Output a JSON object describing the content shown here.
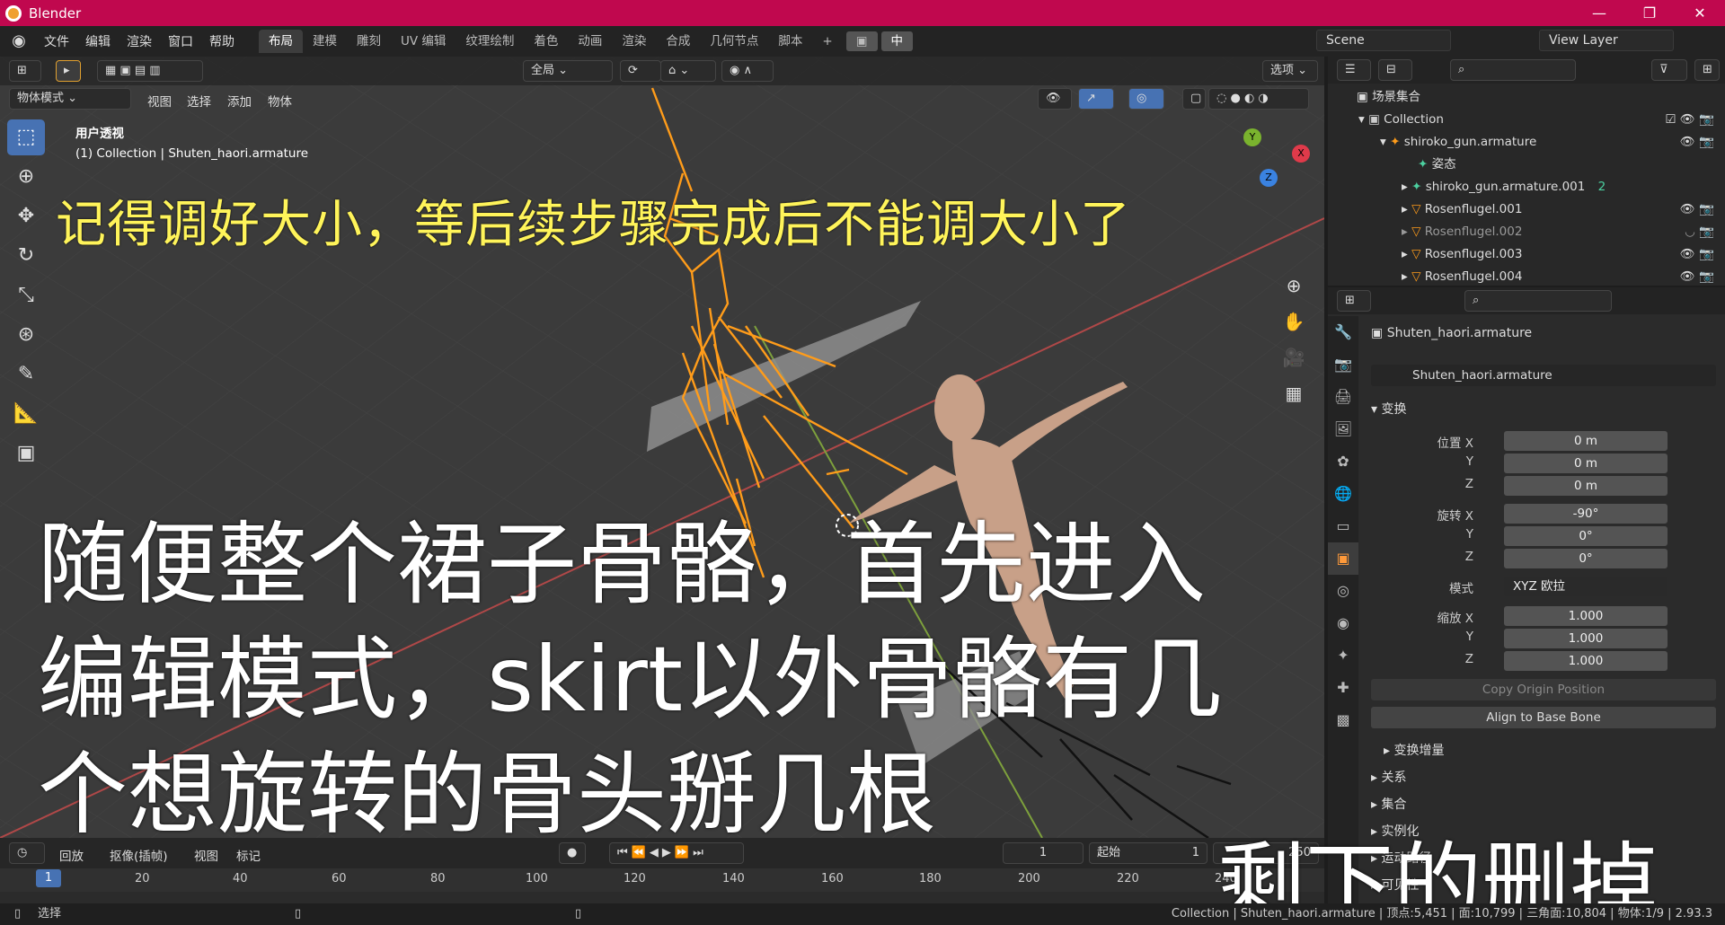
{
  "window": {
    "title": "Blender",
    "min": "—",
    "restore": "❐",
    "close": "✕"
  },
  "menubar": {
    "items": [
      "文件",
      "编辑",
      "渲染",
      "窗口",
      "帮助"
    ],
    "tabs": [
      "布局",
      "建模",
      "雕刻",
      "UV 编辑",
      "纹理绘制",
      "着色",
      "动画",
      "渲染",
      "合成",
      "几何节点",
      "脚本"
    ],
    "add_tab": "+",
    "lang_toggle": "中",
    "scene": "Scene",
    "view_layer": "View Layer"
  },
  "viewport": {
    "mode": "物体模式",
    "menus": [
      "视图",
      "选择",
      "添加",
      "物体"
    ],
    "orientation": "全局",
    "options": "选项",
    "view_name": "用户透视",
    "collection_info": "(1) Collection | Shuten_haori.armature",
    "gizmo": {
      "x": "X",
      "y": "Y",
      "z": "Z"
    }
  },
  "captions": {
    "top": "记得调好大小，等后续步骤完成后不能调大小了",
    "main_line1": "随便整个裙子骨骼，首先进入",
    "main_line2": "编辑模式，skirt以外骨骼有几",
    "main_line3": "个想旋转的骨头掰几根",
    "bottom": "剩下的删掉"
  },
  "timeline": {
    "playback": "回放",
    "keying": "抠像(插帧)",
    "view": "视图",
    "marker": "标记",
    "current_frame": "1",
    "start_label": "起始",
    "start_value": "1",
    "end_value": "250",
    "ruler": [
      "1",
      "20",
      "40",
      "60",
      "80",
      "100",
      "120",
      "140",
      "160",
      "180",
      "200",
      "220",
      "240"
    ]
  },
  "status": {
    "left": "选择",
    "right": "Collection | Shuten_haori.armature | 顶点:5,451 | 面:10,799 | 三角面:10,804 | 物体:1/9 | 2.93.3"
  },
  "outliner": {
    "root": "场景集合",
    "items": [
      {
        "name": "Collection",
        "level": 1
      },
      {
        "name": "shiroko_gun.armature",
        "level": 2
      },
      {
        "name": "姿态",
        "level": 3
      },
      {
        "name": "shiroko_gun.armature.001",
        "level": 3,
        "badge": "2"
      },
      {
        "name": "Rosenflugel.001",
        "level": 3
      },
      {
        "name": "Rosenflugel.002",
        "level": 3
      },
      {
        "name": "Rosenflugel.003",
        "level": 3
      },
      {
        "name": "Rosenflugel.004",
        "level": 3
      }
    ]
  },
  "properties": {
    "object_name": "Shuten_haori.armature",
    "data_name": "Shuten_haori.armature",
    "transform_header": "变换",
    "location_label": "位置 X",
    "loc": [
      "0 m",
      "0 m",
      "0 m"
    ],
    "rotation_label": "旋转 X",
    "rot": [
      "-90°",
      "0°",
      "0°"
    ],
    "mode_label": "模式",
    "rotation_mode": "XYZ 欧拉",
    "scale_label": "缩放 X",
    "scale": [
      "1.000",
      "1.000",
      "1.000"
    ],
    "y": "Y",
    "z": "Z",
    "copy_origin": "Copy Origin Position",
    "align_base": "Align to Base Bone",
    "delta_transform": "变换增量",
    "relations": "关系",
    "collections": "集合",
    "instancing": "实例化",
    "motion_paths": "运动路径",
    "visibility": "可见性"
  }
}
